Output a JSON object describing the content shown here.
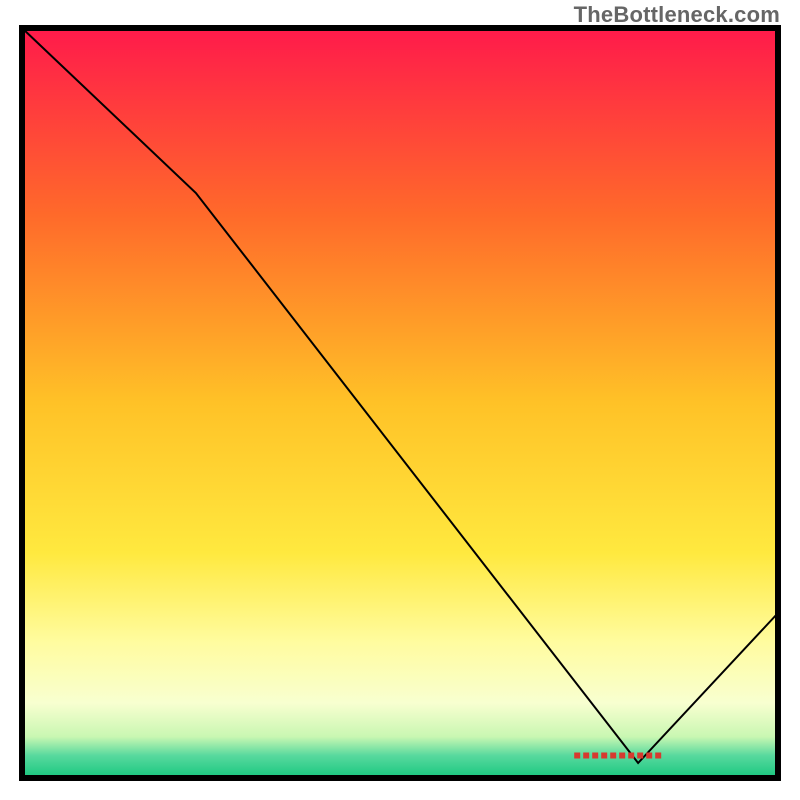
{
  "attribution": "TheBottleneck.com",
  "chart_data": {
    "type": "line",
    "title": "",
    "xlabel": "",
    "ylabel": "",
    "x_range": [
      0,
      100
    ],
    "y_range": [
      0,
      100
    ],
    "axes_visible": false,
    "grid": false,
    "background": {
      "type": "vertical-gradient",
      "stops": [
        {
          "offset": 0.0,
          "color": "#ff1a4b"
        },
        {
          "offset": 0.25,
          "color": "#ff6a2a"
        },
        {
          "offset": 0.5,
          "color": "#ffc227"
        },
        {
          "offset": 0.7,
          "color": "#ffe93f"
        },
        {
          "offset": 0.82,
          "color": "#fffca0"
        },
        {
          "offset": 0.9,
          "color": "#f8ffd0"
        },
        {
          "offset": 0.945,
          "color": "#c9f7b2"
        },
        {
          "offset": 0.97,
          "color": "#58d99e"
        },
        {
          "offset": 1.0,
          "color": "#18c77f"
        }
      ]
    },
    "series": [
      {
        "name": "bottleneck-curve",
        "color": "#000000",
        "width": 2,
        "points": [
          {
            "x": 0.0,
            "y": 100.0
          },
          {
            "x": 23.0,
            "y": 78.0
          },
          {
            "x": 81.5,
            "y": 2.0
          },
          {
            "x": 100.0,
            "y": 22.0
          }
        ]
      }
    ],
    "annotations": [
      {
        "name": "min-marker",
        "text_redacted": true,
        "x": 79.0,
        "y": 3.0,
        "color": "#d63a2f"
      }
    ]
  }
}
